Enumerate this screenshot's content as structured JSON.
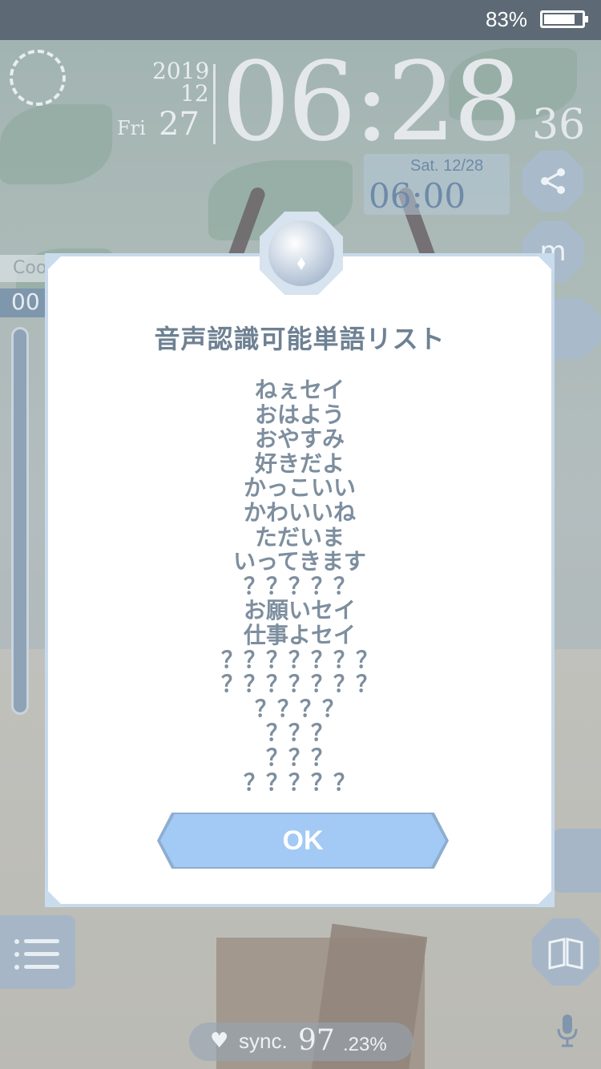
{
  "status_bar": {
    "battery_percent": "83%",
    "battery_level": 0.83
  },
  "clock": {
    "year": "2019",
    "month": "12",
    "day": "27",
    "weekday": "Fri",
    "time": "06:28",
    "seconds": "36"
  },
  "alarm": {
    "date": "Sat.  12/28",
    "time": "06:00"
  },
  "side_panel": {
    "label": "Coo",
    "value": "00"
  },
  "sync": {
    "label": "sync.",
    "value": "97",
    "decimal": ".23%"
  },
  "dialog": {
    "title": "音声認識可能単語リスト",
    "words": [
      "ねぇセイ",
      "おはよう",
      "おやすみ",
      "好きだよ",
      "かっこいい",
      "かわいいね",
      "ただいま",
      "いってきます",
      "？？？？？",
      "お願いセイ",
      "仕事よセイ",
      "？？？？？？？",
      "？？？？？？？",
      "？？？？",
      "？？？",
      "？？？",
      "？？？？？"
    ],
    "ok_label": "OK"
  },
  "icons": {
    "share": "share-icon",
    "wardrobe": "m-icon",
    "menu": "list-icon",
    "book": "book-icon",
    "moon": "moon-icon",
    "mic": "mic-icon"
  }
}
